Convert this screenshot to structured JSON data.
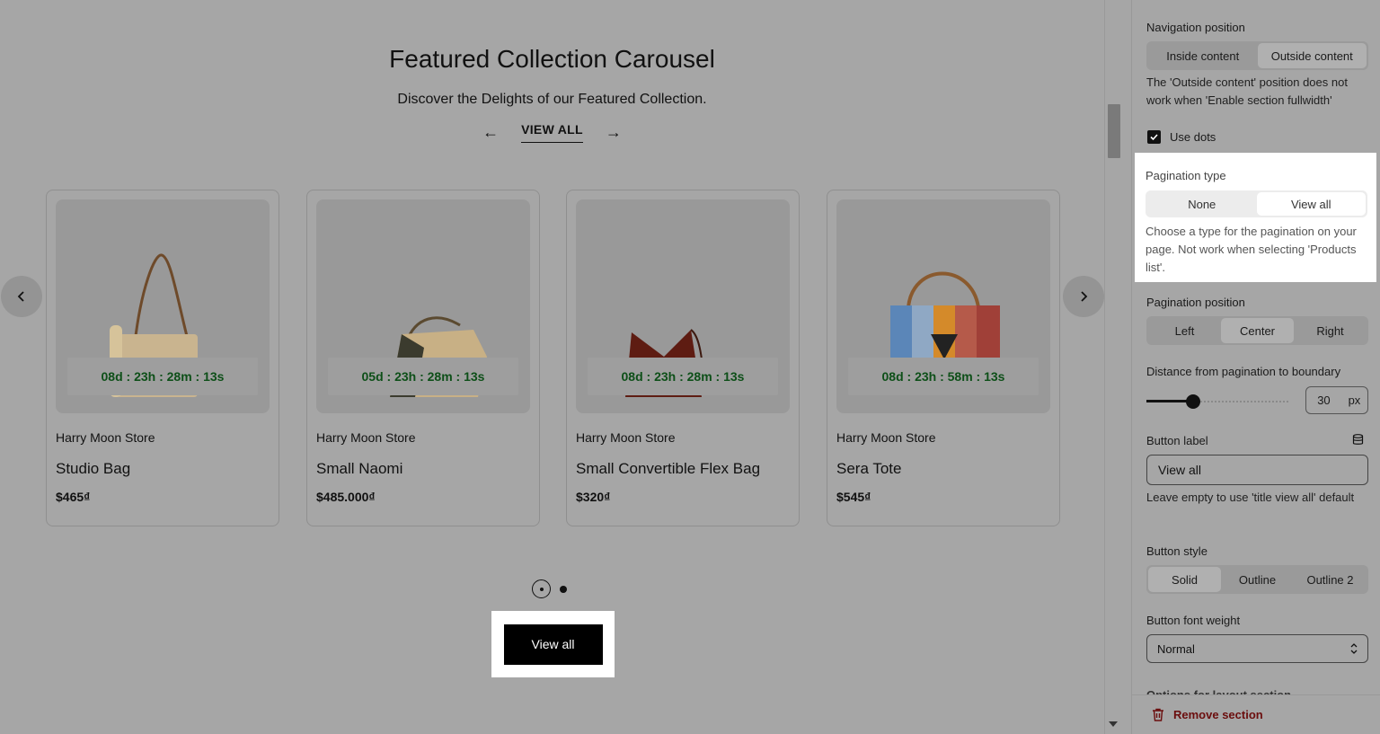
{
  "section": {
    "heading": "Featured Collection Carousel",
    "subheading": "Discover the Delights of our Featured Collection.",
    "view_all_link": "VIEW ALL",
    "view_all_button": "View all"
  },
  "products": [
    {
      "vendor": "Harry Moon Store",
      "title": "Studio Bag",
      "price": "$465₫",
      "countdown": "08d : 23h : 28m : 13s"
    },
    {
      "vendor": "Harry Moon Store",
      "title": "Small Naomi",
      "price": "$485.000₫",
      "countdown": "05d : 23h : 28m : 13s"
    },
    {
      "vendor": "Harry Moon Store",
      "title": "Small Convertible Flex Bag",
      "price": "$320₫",
      "countdown": "08d : 23h : 28m : 13s"
    },
    {
      "vendor": "Harry Moon Store",
      "title": "Sera Tote",
      "price": "$545₫",
      "countdown": "08d : 23h : 58m : 13s"
    }
  ],
  "pagination_dots": {
    "total": 2,
    "active": 1
  },
  "panel": {
    "navigation_position": {
      "label": "Navigation position",
      "options": [
        "Inside content",
        "Outside content"
      ],
      "selected": "Outside content",
      "help": "The 'Outside content' position does not work when 'Enable section fullwidth'"
    },
    "use_dots": {
      "label": "Use dots",
      "checked": true
    },
    "pagination_type": {
      "label": "Pagination type",
      "options": [
        "None",
        "View all"
      ],
      "selected": "View all",
      "help": "Choose a type for the pagination on your page. Not work when selecting 'Products list'."
    },
    "pagination_position": {
      "label": "Pagination position",
      "options": [
        "Left",
        "Center",
        "Right"
      ],
      "selected": "Center"
    },
    "distance": {
      "label": "Distance from pagination to boundary",
      "value": "30",
      "unit": "px",
      "slider_fraction": 0.3
    },
    "button_label": {
      "label": "Button label",
      "value": "View all",
      "help": "Leave empty to use 'title view all' default"
    },
    "button_style": {
      "label": "Button style",
      "options": [
        "Solid",
        "Outline",
        "Outline 2"
      ],
      "selected": "Solid"
    },
    "button_font_weight": {
      "label": "Button font weight",
      "value": "Normal"
    },
    "cutoff_label": "Options for layout section",
    "remove_section": "Remove section"
  }
}
